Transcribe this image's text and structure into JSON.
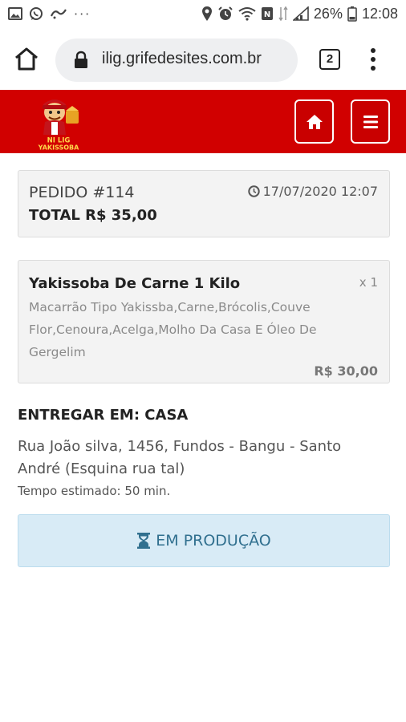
{
  "status_bar": {
    "battery": "26%",
    "time": "12:08",
    "left_icons": [
      "image-icon",
      "whatsapp-icon",
      "app-icon",
      "more-dots-icon"
    ],
    "right_icons": [
      "location-icon",
      "alarm-icon",
      "wifi-icon",
      "nfc-icon",
      "data-icon",
      "signal-icon"
    ]
  },
  "browser": {
    "url": "ilig.grifedesites.com.br",
    "tab_count": "2"
  },
  "colors": {
    "header_red": "#d10000",
    "status_blue": "#31708f",
    "status_bg": "#d8ebf6"
  },
  "order": {
    "number_label": "PEDIDO #114",
    "total_label": "TOTAL R$ 35,00",
    "datetime": "17/07/2020 12:07"
  },
  "item": {
    "name": "Yakissoba De Carne 1 Kilo",
    "qty": "x 1",
    "description": "Macarrão Tipo Yakissba,Carne,Brócolis,Couve Flor,Cenoura,Acelga,Molho Da Casa E Óleo De Gergelim",
    "price": "R$ 30,00"
  },
  "delivery": {
    "title": "ENTREGAR EM: CASA",
    "address": "Rua João silva, 1456, Fundos - Bangu - Santo André (Esquina rua tal)",
    "estimated_time": "Tempo estimado: 50 min."
  },
  "status": {
    "label": "EM PRODUÇÃO",
    "icon": "hourglass-icon"
  }
}
